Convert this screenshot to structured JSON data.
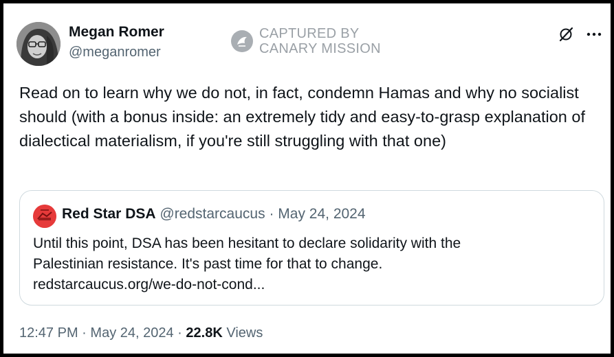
{
  "watermark": {
    "line1": "CAPTURED BY",
    "line2": "CANARY MISSION"
  },
  "tweet": {
    "author_name": "Megan Romer",
    "author_handle": "@meganromer",
    "text": "Read on to learn why we do not, in fact, condemn Hamas and why no socialist should (with a bonus inside: an extremely tidy and easy-to-grasp explanation of dialectical materialism, if you're still struggling with that one)",
    "time": "12:47 PM",
    "date": "May 24, 2024",
    "views_count": "22.8K",
    "views_label": "Views"
  },
  "quoted_tweet": {
    "author_name": "Red Star DSA",
    "author_handle": "@redstarcaucus",
    "date": "May 24, 2024",
    "text_line1": "Until this point, DSA has been hesitant to declare solidarity with the",
    "text_line2": "Palestinian resistance. It's past time for that to change.",
    "link": "redstarcaucus.org/we-do-not-cond..."
  },
  "icons": {
    "avatar": "user-avatar",
    "watermark": "canary-mission-logo",
    "grok": "grok-icon",
    "more": "more-icon",
    "quoted_avatar": "red-star-dsa-avatar"
  },
  "colors": {
    "text": "#0f1419",
    "muted": "#536471",
    "border": "#cfd9de",
    "watermark": "#9aa0a6",
    "quoted_avatar": "#e63a3a",
    "frame": "#000000"
  }
}
